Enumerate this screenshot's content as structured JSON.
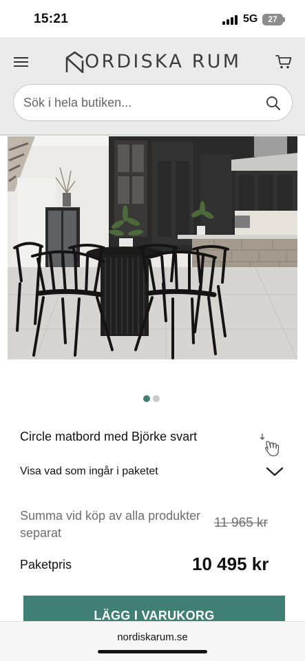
{
  "status_bar": {
    "time": "15:21",
    "network": "5G",
    "battery": "27"
  },
  "header": {
    "logo_text": "ORDISKA RUM",
    "logo_mark": "N",
    "menu_icon": "hamburger-menu-icon",
    "cart_icon": "shopping-cart-icon",
    "search_placeholder": "Sök i hela butiken...",
    "search_icon": "search-icon"
  },
  "product": {
    "image_icon": "dining-set-photo",
    "carousel": {
      "count": 2,
      "active": 0
    },
    "title": "Circle matbord med Björke svart",
    "package_toggle_label": "Visa vad som ingår i paketet",
    "separate_sum_label": "Summa vid köp av alla produkter separat",
    "separate_sum_price": "11 965 kr",
    "package_price_label": "Paketpris",
    "package_price": "10 495 kr",
    "add_to_cart_label": "LÄGG I VARUKORG"
  },
  "browser": {
    "url": "nordiskarum.se"
  },
  "colors": {
    "accent": "#3f7f74",
    "header_bg": "#ebebeb",
    "muted_text": "#6e6e6e"
  }
}
